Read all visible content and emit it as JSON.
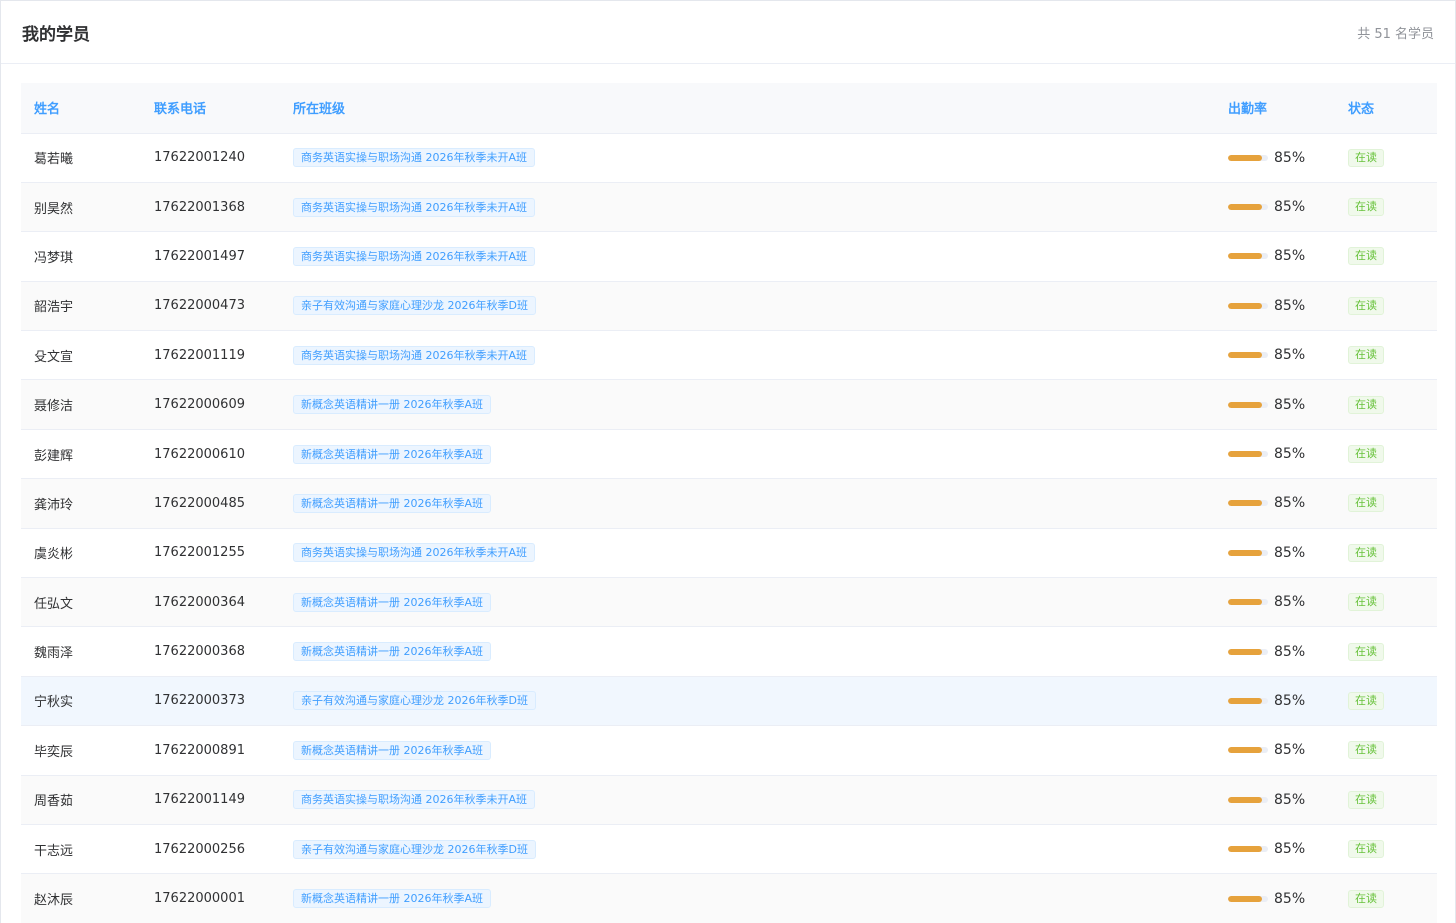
{
  "header": {
    "title": "我的学员",
    "count_text": "共 51 名学员"
  },
  "columns": [
    "姓名",
    "联系电话",
    "所在班级",
    "出勤率",
    "状态"
  ],
  "colors": {
    "accent": "#409eff",
    "bar": "#e6a23c",
    "success": "#67c23a"
  },
  "students": [
    {
      "name": "葛若曦",
      "phone": "17622001240",
      "class": "商务英语实操与职场沟通 2026年秋季未开A班",
      "attendance": 85,
      "attendance_text": "85%",
      "status": "在读"
    },
    {
      "name": "别昊然",
      "phone": "17622001368",
      "class": "商务英语实操与职场沟通 2026年秋季未开A班",
      "attendance": 85,
      "attendance_text": "85%",
      "status": "在读"
    },
    {
      "name": "冯梦琪",
      "phone": "17622001497",
      "class": "商务英语实操与职场沟通 2026年秋季未开A班",
      "attendance": 85,
      "attendance_text": "85%",
      "status": "在读"
    },
    {
      "name": "韶浩宇",
      "phone": "17622000473",
      "class": "亲子有效沟通与家庭心理沙龙 2026年秋季D班",
      "attendance": 85,
      "attendance_text": "85%",
      "status": "在读"
    },
    {
      "name": "殳文宣",
      "phone": "17622001119",
      "class": "商务英语实操与职场沟通 2026年秋季未开A班",
      "attendance": 85,
      "attendance_text": "85%",
      "status": "在读"
    },
    {
      "name": "聂修洁",
      "phone": "17622000609",
      "class": "新概念英语精讲一册 2026年秋季A班",
      "attendance": 85,
      "attendance_text": "85%",
      "status": "在读"
    },
    {
      "name": "彭建辉",
      "phone": "17622000610",
      "class": "新概念英语精讲一册 2026年秋季A班",
      "attendance": 85,
      "attendance_text": "85%",
      "status": "在读"
    },
    {
      "name": "龚沛玲",
      "phone": "17622000485",
      "class": "新概念英语精讲一册 2026年秋季A班",
      "attendance": 85,
      "attendance_text": "85%",
      "status": "在读"
    },
    {
      "name": "虞炎彬",
      "phone": "17622001255",
      "class": "商务英语实操与职场沟通 2026年秋季未开A班",
      "attendance": 85,
      "attendance_text": "85%",
      "status": "在读"
    },
    {
      "name": "任弘文",
      "phone": "17622000364",
      "class": "新概念英语精讲一册 2026年秋季A班",
      "attendance": 85,
      "attendance_text": "85%",
      "status": "在读"
    },
    {
      "name": "魏雨泽",
      "phone": "17622000368",
      "class": "新概念英语精讲一册 2026年秋季A班",
      "attendance": 85,
      "attendance_text": "85%",
      "status": "在读"
    },
    {
      "name": "宁秋实",
      "phone": "17622000373",
      "class": "亲子有效沟通与家庭心理沙龙 2026年秋季D班",
      "attendance": 85,
      "attendance_text": "85%",
      "status": "在读"
    },
    {
      "name": "毕奕辰",
      "phone": "17622000891",
      "class": "新概念英语精讲一册 2026年秋季A班",
      "attendance": 85,
      "attendance_text": "85%",
      "status": "在读"
    },
    {
      "name": "周香茹",
      "phone": "17622001149",
      "class": "商务英语实操与职场沟通 2026年秋季未开A班",
      "attendance": 85,
      "attendance_text": "85%",
      "status": "在读"
    },
    {
      "name": "干志远",
      "phone": "17622000256",
      "class": "亲子有效沟通与家庭心理沙龙 2026年秋季D班",
      "attendance": 85,
      "attendance_text": "85%",
      "status": "在读"
    },
    {
      "name": "赵沐辰",
      "phone": "17622000001",
      "class": "新概念英语精讲一册 2026年秋季A班",
      "attendance": 85,
      "attendance_text": "85%",
      "status": "在读"
    }
  ]
}
